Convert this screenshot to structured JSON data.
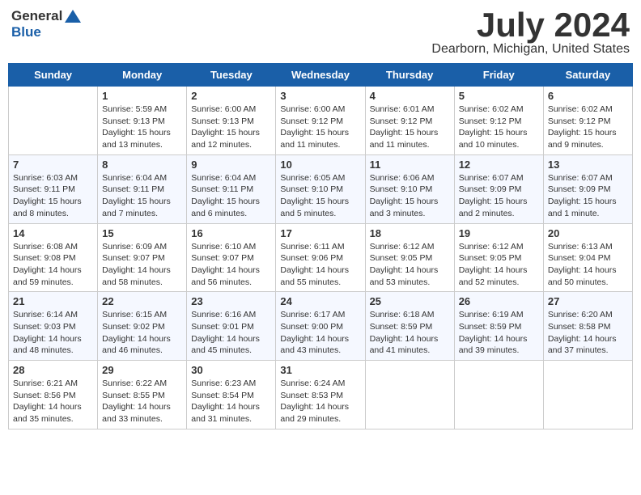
{
  "header": {
    "logo_general": "General",
    "logo_blue": "Blue",
    "month_title": "July 2024",
    "location": "Dearborn, Michigan, United States"
  },
  "weekdays": [
    "Sunday",
    "Monday",
    "Tuesday",
    "Wednesday",
    "Thursday",
    "Friday",
    "Saturday"
  ],
  "weeks": [
    [
      {
        "day": "",
        "info": ""
      },
      {
        "day": "1",
        "info": "Sunrise: 5:59 AM\nSunset: 9:13 PM\nDaylight: 15 hours\nand 13 minutes."
      },
      {
        "day": "2",
        "info": "Sunrise: 6:00 AM\nSunset: 9:13 PM\nDaylight: 15 hours\nand 12 minutes."
      },
      {
        "day": "3",
        "info": "Sunrise: 6:00 AM\nSunset: 9:12 PM\nDaylight: 15 hours\nand 11 minutes."
      },
      {
        "day": "4",
        "info": "Sunrise: 6:01 AM\nSunset: 9:12 PM\nDaylight: 15 hours\nand 11 minutes."
      },
      {
        "day": "5",
        "info": "Sunrise: 6:02 AM\nSunset: 9:12 PM\nDaylight: 15 hours\nand 10 minutes."
      },
      {
        "day": "6",
        "info": "Sunrise: 6:02 AM\nSunset: 9:12 PM\nDaylight: 15 hours\nand 9 minutes."
      }
    ],
    [
      {
        "day": "7",
        "info": "Sunrise: 6:03 AM\nSunset: 9:11 PM\nDaylight: 15 hours\nand 8 minutes."
      },
      {
        "day": "8",
        "info": "Sunrise: 6:04 AM\nSunset: 9:11 PM\nDaylight: 15 hours\nand 7 minutes."
      },
      {
        "day": "9",
        "info": "Sunrise: 6:04 AM\nSunset: 9:11 PM\nDaylight: 15 hours\nand 6 minutes."
      },
      {
        "day": "10",
        "info": "Sunrise: 6:05 AM\nSunset: 9:10 PM\nDaylight: 15 hours\nand 5 minutes."
      },
      {
        "day": "11",
        "info": "Sunrise: 6:06 AM\nSunset: 9:10 PM\nDaylight: 15 hours\nand 3 minutes."
      },
      {
        "day": "12",
        "info": "Sunrise: 6:07 AM\nSunset: 9:09 PM\nDaylight: 15 hours\nand 2 minutes."
      },
      {
        "day": "13",
        "info": "Sunrise: 6:07 AM\nSunset: 9:09 PM\nDaylight: 15 hours\nand 1 minute."
      }
    ],
    [
      {
        "day": "14",
        "info": "Sunrise: 6:08 AM\nSunset: 9:08 PM\nDaylight: 14 hours\nand 59 minutes."
      },
      {
        "day": "15",
        "info": "Sunrise: 6:09 AM\nSunset: 9:07 PM\nDaylight: 14 hours\nand 58 minutes."
      },
      {
        "day": "16",
        "info": "Sunrise: 6:10 AM\nSunset: 9:07 PM\nDaylight: 14 hours\nand 56 minutes."
      },
      {
        "day": "17",
        "info": "Sunrise: 6:11 AM\nSunset: 9:06 PM\nDaylight: 14 hours\nand 55 minutes."
      },
      {
        "day": "18",
        "info": "Sunrise: 6:12 AM\nSunset: 9:05 PM\nDaylight: 14 hours\nand 53 minutes."
      },
      {
        "day": "19",
        "info": "Sunrise: 6:12 AM\nSunset: 9:05 PM\nDaylight: 14 hours\nand 52 minutes."
      },
      {
        "day": "20",
        "info": "Sunrise: 6:13 AM\nSunset: 9:04 PM\nDaylight: 14 hours\nand 50 minutes."
      }
    ],
    [
      {
        "day": "21",
        "info": "Sunrise: 6:14 AM\nSunset: 9:03 PM\nDaylight: 14 hours\nand 48 minutes."
      },
      {
        "day": "22",
        "info": "Sunrise: 6:15 AM\nSunset: 9:02 PM\nDaylight: 14 hours\nand 46 minutes."
      },
      {
        "day": "23",
        "info": "Sunrise: 6:16 AM\nSunset: 9:01 PM\nDaylight: 14 hours\nand 45 minutes."
      },
      {
        "day": "24",
        "info": "Sunrise: 6:17 AM\nSunset: 9:00 PM\nDaylight: 14 hours\nand 43 minutes."
      },
      {
        "day": "25",
        "info": "Sunrise: 6:18 AM\nSunset: 8:59 PM\nDaylight: 14 hours\nand 41 minutes."
      },
      {
        "day": "26",
        "info": "Sunrise: 6:19 AM\nSunset: 8:59 PM\nDaylight: 14 hours\nand 39 minutes."
      },
      {
        "day": "27",
        "info": "Sunrise: 6:20 AM\nSunset: 8:58 PM\nDaylight: 14 hours\nand 37 minutes."
      }
    ],
    [
      {
        "day": "28",
        "info": "Sunrise: 6:21 AM\nSunset: 8:56 PM\nDaylight: 14 hours\nand 35 minutes."
      },
      {
        "day": "29",
        "info": "Sunrise: 6:22 AM\nSunset: 8:55 PM\nDaylight: 14 hours\nand 33 minutes."
      },
      {
        "day": "30",
        "info": "Sunrise: 6:23 AM\nSunset: 8:54 PM\nDaylight: 14 hours\nand 31 minutes."
      },
      {
        "day": "31",
        "info": "Sunrise: 6:24 AM\nSunset: 8:53 PM\nDaylight: 14 hours\nand 29 minutes."
      },
      {
        "day": "",
        "info": ""
      },
      {
        "day": "",
        "info": ""
      },
      {
        "day": "",
        "info": ""
      }
    ]
  ]
}
